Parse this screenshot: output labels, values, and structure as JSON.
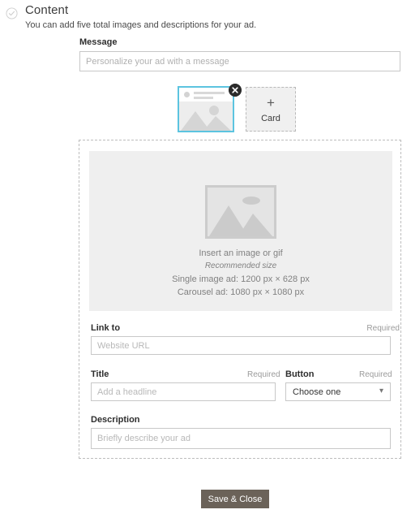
{
  "header": {
    "status_icon": "check-circle-icon",
    "title": "Content",
    "subtitle": "You can add five total images and descriptions for your ad."
  },
  "message": {
    "label": "Message",
    "placeholder": "Personalize your ad with a message",
    "value": ""
  },
  "cards": {
    "thumbnail": {
      "icon": "image-thumbnail-icon",
      "selected": true,
      "remove_icon": "close-circle-icon",
      "border_color": "#5cc4e0"
    },
    "add": {
      "plus_icon": "plus-icon",
      "label": "Card"
    }
  },
  "dropzone": {
    "icon": "image-placeholder-icon",
    "line1": "Insert an image or gif",
    "line2": "Recommended size",
    "line3": "Single image ad: 1200 px × 628 px",
    "line4": "Carousel ad: 1080 px × 1080 px"
  },
  "fields": {
    "link_to": {
      "label": "Link to",
      "required_text": "Required",
      "placeholder": "Website URL",
      "value": ""
    },
    "title": {
      "label": "Title",
      "required_text": "Required",
      "placeholder": "Add a headline",
      "value": ""
    },
    "button": {
      "label": "Button",
      "required_text": "Required",
      "selected": "Choose one",
      "caret_icon": "chevron-down-icon",
      "options": [
        "Choose one"
      ]
    },
    "description": {
      "label": "Description",
      "placeholder": "Briefly describe your ad",
      "value": ""
    }
  },
  "footer": {
    "save_label": "Save & Close",
    "save_color": "#6b6259"
  }
}
